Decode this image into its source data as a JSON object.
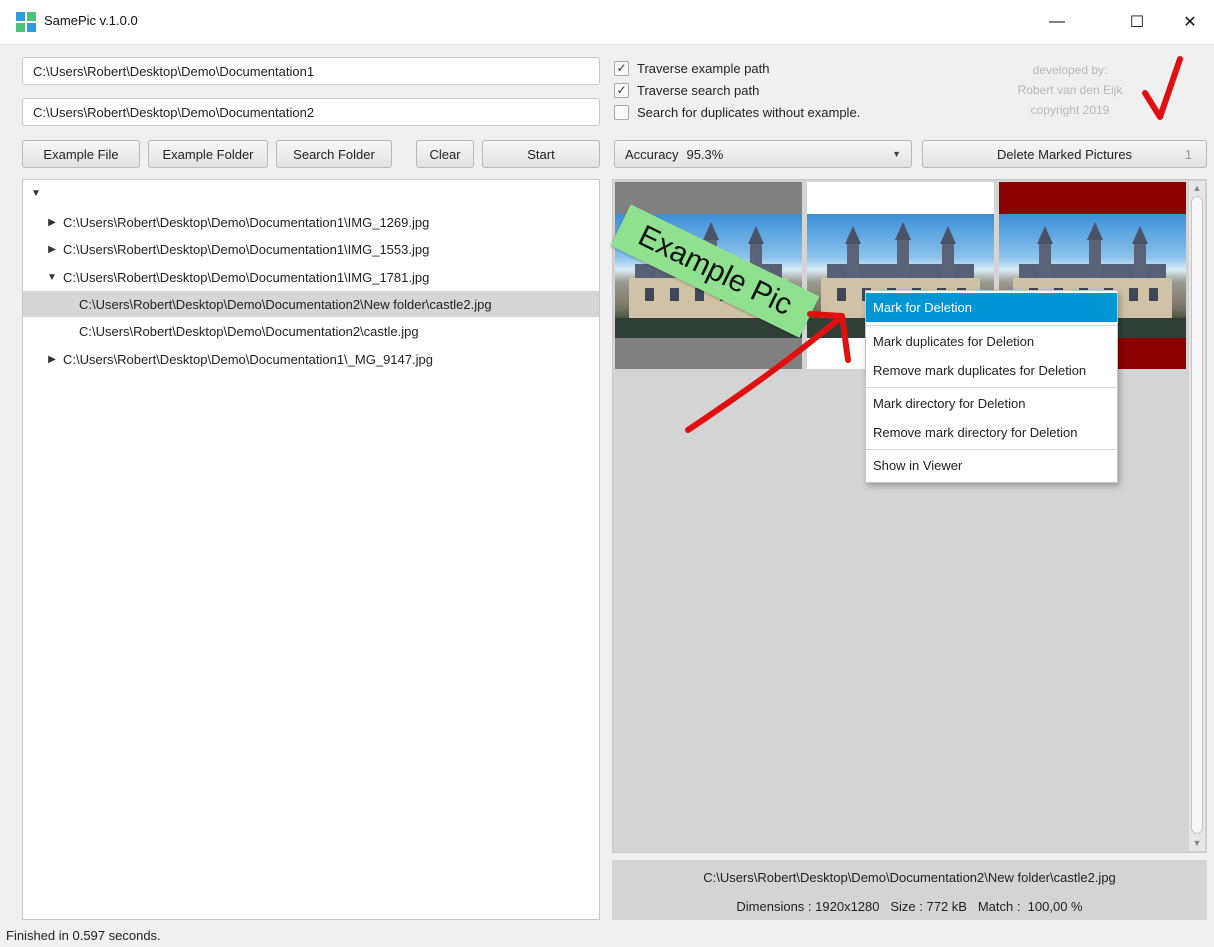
{
  "window": {
    "title": "SamePic v.1.0.0",
    "minimize": "—",
    "maximize": "☐",
    "close": "✕"
  },
  "paths": {
    "example_path": "C:\\Users\\Robert\\Desktop\\Demo\\Documentation1",
    "search_path": "C:\\Users\\Robert\\Desktop\\Demo\\Documentation2"
  },
  "options": [
    {
      "label": "Traverse example path",
      "checked": true
    },
    {
      "label": "Traverse search path",
      "checked": true
    },
    {
      "label": "Search for duplicates without example.",
      "checked": false
    }
  ],
  "credit": {
    "line1": "developed by:",
    "line2": "Robert van den Eijk",
    "line3": "copyright 2019"
  },
  "toolbar": {
    "example_file": "Example File",
    "example_folder": "Example Folder",
    "search_folder": "Search Folder",
    "clear": "Clear",
    "start": "Start"
  },
  "accuracy": {
    "label": "Accuracy",
    "value": "95.3%"
  },
  "delete_button": {
    "label": "Delete Marked Pictures",
    "count": "1"
  },
  "tree": [
    {
      "text": "",
      "level": 0,
      "expand": "▼"
    },
    {
      "text": "C:\\Users\\Robert\\Desktop\\Demo\\Documentation1\\IMG_1269.jpg",
      "level": 1,
      "expand": "▶"
    },
    {
      "text": "C:\\Users\\Robert\\Desktop\\Demo\\Documentation1\\IMG_1553.jpg",
      "level": 1,
      "expand": "▶"
    },
    {
      "text": "C:\\Users\\Robert\\Desktop\\Demo\\Documentation1\\IMG_1781.jpg",
      "level": 1,
      "expand": "▼"
    },
    {
      "text": "C:\\Users\\Robert\\Desktop\\Demo\\Documentation2\\New folder\\castle2.jpg",
      "level": 2,
      "expand": "",
      "selected": true
    },
    {
      "text": "C:\\Users\\Robert\\Desktop\\Demo\\Documentation2\\castle.jpg",
      "level": 2,
      "expand": ""
    },
    {
      "text": "C:\\Users\\Robert\\Desktop\\Demo\\Documentation1\\_MG_9147.jpg",
      "level": 1,
      "expand": "▶"
    }
  ],
  "gallery": {
    "example_label": "Example Pic",
    "thumb_colors": [
      "#808080",
      "#ffffff",
      "#8b0000"
    ]
  },
  "context_menu": [
    {
      "label": "Mark for Deletion",
      "active": true
    },
    {
      "label": "Mark duplicates for Deletion"
    },
    {
      "label": "Remove mark duplicates for Deletion"
    },
    {
      "label": "Mark directory for Deletion"
    },
    {
      "label": "Remove mark directory for Deletion"
    },
    {
      "label": "Show in Viewer"
    }
  ],
  "info": {
    "path": "C:\\Users\\Robert\\Desktop\\Demo\\Documentation2\\New folder\\castle2.jpg",
    "dimensions_label": "Dimensions :",
    "dimensions": "1920x1280",
    "size_label": "Size :",
    "size": "772 kB",
    "match_label": "Match :",
    "match": "100,00 %"
  },
  "status": "Finished in 0.597 seconds.",
  "colors": {
    "accent": "#0096d6",
    "annotation_red": "#e01010",
    "banner_green": "#8fe08f"
  }
}
